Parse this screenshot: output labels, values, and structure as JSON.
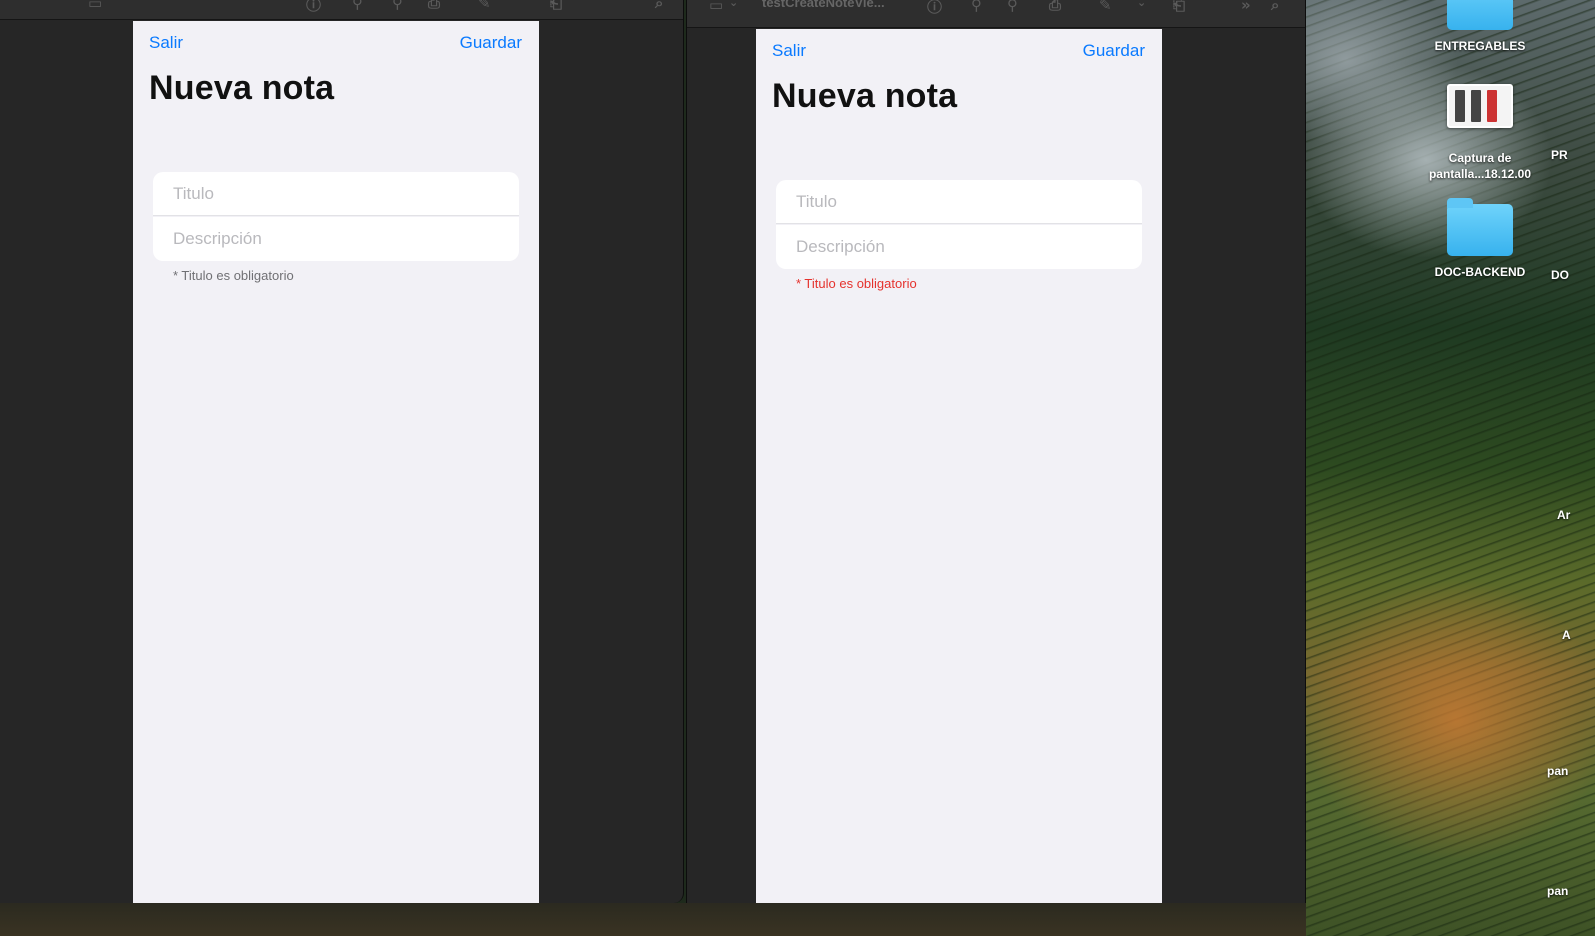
{
  "left_window": {
    "nav": {
      "left_label": "Salir",
      "right_label": "Guardar"
    },
    "title": "Nueva nota",
    "fields": {
      "title_placeholder": "Titulo",
      "description_placeholder": "Descripción"
    },
    "hint": "* Titulo es obligatorio",
    "hint_color": "#707074"
  },
  "right_window": {
    "toolbar_title": "testCreateNoteVie...",
    "nav": {
      "left_label": "Salir",
      "right_label": "Guardar"
    },
    "title": "Nueva nota",
    "fields": {
      "title_placeholder": "Titulo",
      "description_placeholder": "Descripción"
    },
    "hint": "* Titulo es obligatorio",
    "hint_color": "#e5322d"
  },
  "desktop": {
    "items": [
      {
        "label": "ENTREGABLES",
        "icon": "folder-icon"
      },
      {
        "label": "Captura de pantalla...18.12.00",
        "icon": "screenshot-thumbnail"
      },
      {
        "label": "DOC-BACKEND",
        "icon": "folder-icon"
      }
    ],
    "edge_labels": [
      "PR",
      "DO",
      "Ar",
      "A",
      "pan",
      "pan"
    ]
  },
  "colors": {
    "accent": "#0a7aff",
    "background": "#f2f1f6",
    "window_chrome": "#262626"
  }
}
